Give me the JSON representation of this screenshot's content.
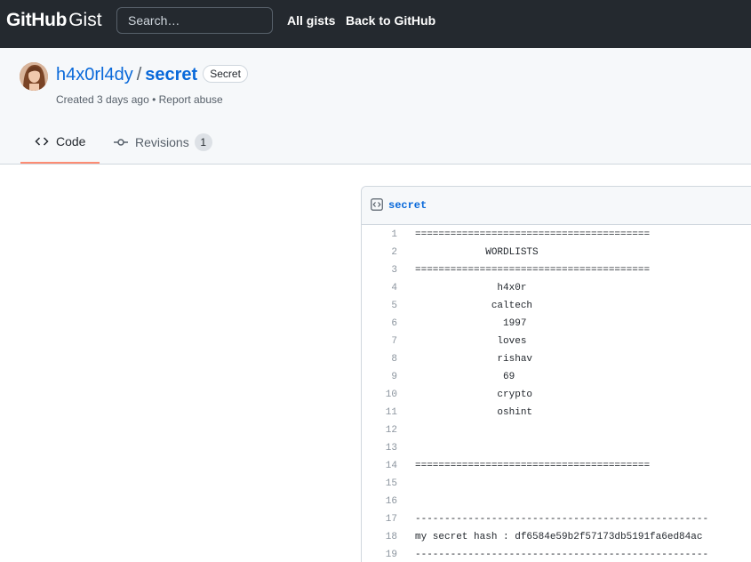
{
  "header": {
    "logo_bold": "GitHub",
    "logo_light": "Gist",
    "search_placeholder": "Search…",
    "nav": [
      "All gists",
      "Back to GitHub"
    ]
  },
  "gist": {
    "author": "h4x0rl4dy",
    "separator": "/",
    "name": "secret",
    "badge": "Secret",
    "meta_created": "Created 3 days ago",
    "meta_sep": "•",
    "meta_report": "Report abuse"
  },
  "tabs": [
    {
      "label": "Code",
      "icon": "code-icon",
      "selected": true
    },
    {
      "label": "Revisions",
      "icon": "git-commit-icon",
      "count": "1"
    }
  ],
  "file": {
    "name": "secret",
    "lines": [
      {
        "n": "1",
        "text": "========================================"
      },
      {
        "n": "2",
        "text": "            WORDLISTS"
      },
      {
        "n": "3",
        "text": "========================================"
      },
      {
        "n": "4",
        "text": "              h4x0r"
      },
      {
        "n": "5",
        "text": "             caltech"
      },
      {
        "n": "6",
        "text": "               1997"
      },
      {
        "n": "7",
        "text": "              loves"
      },
      {
        "n": "8",
        "text": "              rishav"
      },
      {
        "n": "9",
        "text": "               69"
      },
      {
        "n": "10",
        "text": "              crypto"
      },
      {
        "n": "11",
        "text": "              oshint"
      },
      {
        "n": "12",
        "text": ""
      },
      {
        "n": "13",
        "text": ""
      },
      {
        "n": "14",
        "text": "========================================"
      },
      {
        "n": "15",
        "text": ""
      },
      {
        "n": "16",
        "text": ""
      },
      {
        "n": "17",
        "text": "--------------------------------------------------"
      },
      {
        "n": "18",
        "text": "my secret hash : df6584e59b2f57173db5191fa6ed84ac"
      },
      {
        "n": "19",
        "text": "--------------------------------------------------"
      }
    ]
  },
  "colors": {
    "header_bg": "#24292f",
    "link": "#0969da",
    "tab_underline": "#fd8c73"
  }
}
